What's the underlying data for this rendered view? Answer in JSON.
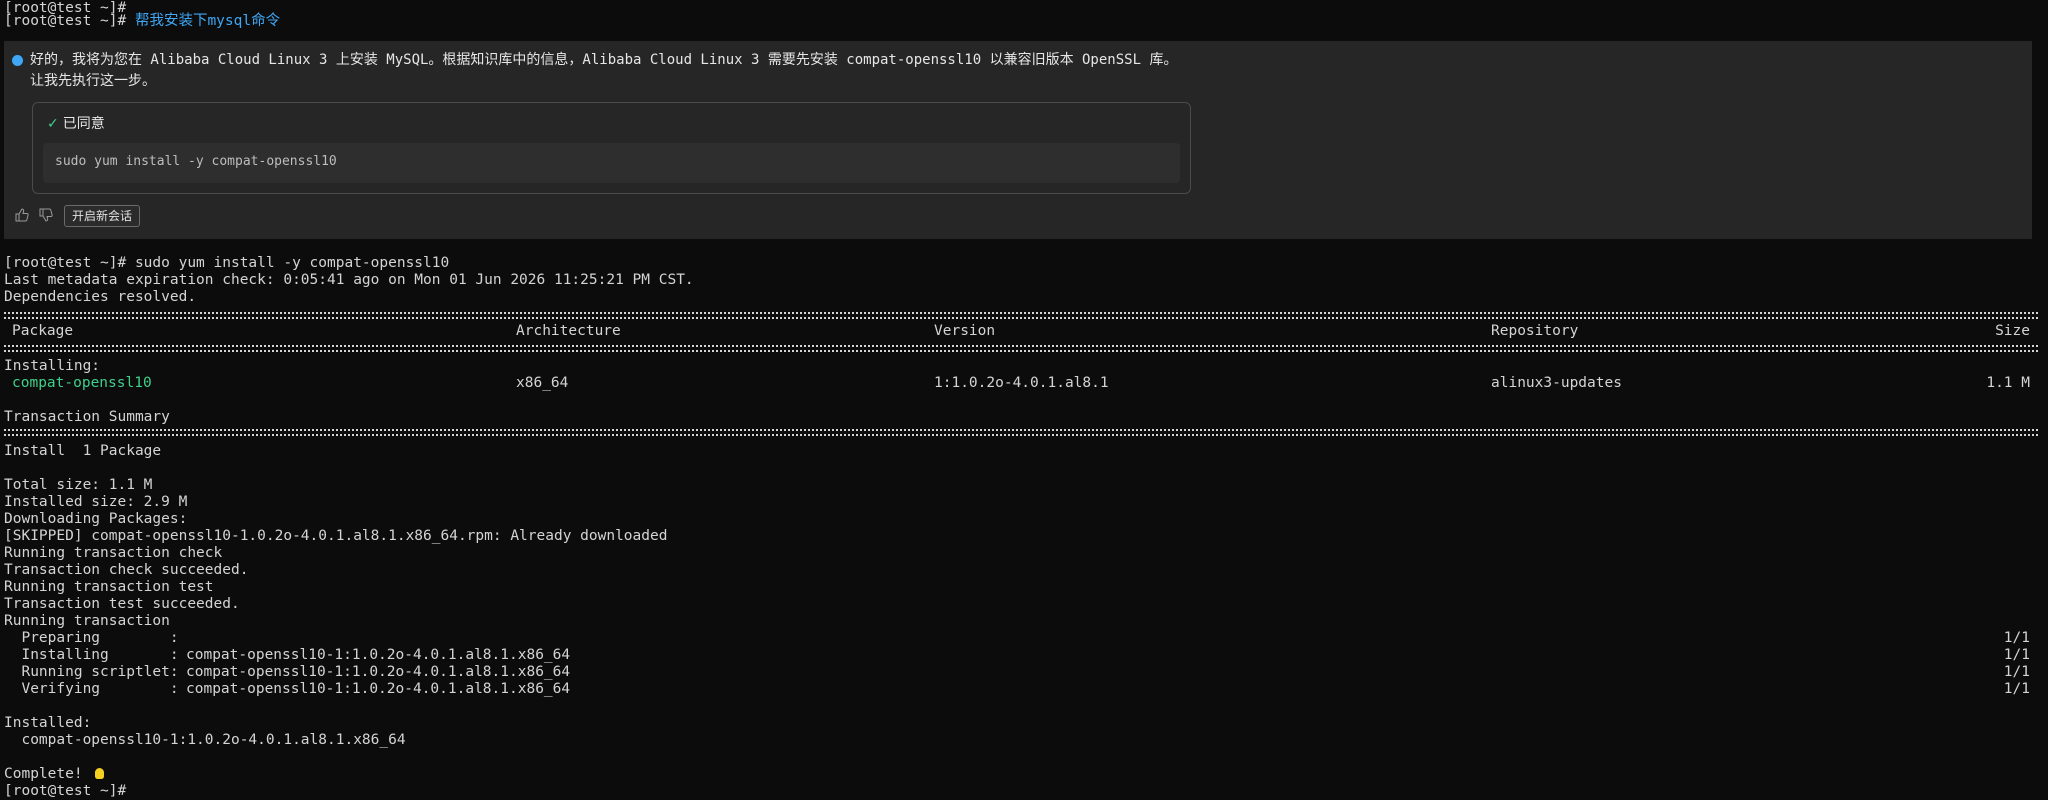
{
  "prompt_user": "[root@test ~]#",
  "first_line": "[root@test ~]#",
  "user_request": "帮我安装下mysql命令",
  "ai": {
    "message": "好的，我将为您在 Alibaba Cloud Linux 3 上安装 MySQL。根据知识库中的信息，Alibaba Cloud Linux 3 需要先安装 compat-openssl10 以兼容旧版本 OpenSSL 库。让我先执行这一步。",
    "approved_label": "已同意",
    "command": "sudo yum install -y compat-openssl10",
    "new_chat_label": "开启新会话",
    "icons": {
      "like": "thumbs-up-icon",
      "dislike": "thumbs-down-icon",
      "check": "check-icon",
      "status": "status-dot-icon"
    },
    "accent": "#3fa7f5"
  },
  "output": {
    "cmd_line": "[root@test ~]# sudo yum install -y compat-openssl10",
    "metadata": "Last metadata expiration check: 0:05:41 ago on Mon 01 Jun 2026 11:25:21 PM CST.",
    "deps": "Dependencies resolved.",
    "headers": {
      "package": "Package",
      "arch": "Architecture",
      "version": "Version",
      "repo": "Repository",
      "size": "Size"
    },
    "installing_label": "Installing:",
    "pkg": {
      "name": "compat-openssl10",
      "arch": "x86_64",
      "version": "1:1.0.2o-4.0.1.al8.1",
      "repo": "alinux3-updates",
      "size": "1.1 M"
    },
    "summary_title": "Transaction Summary",
    "install_count": "Install  1 Package",
    "total_size": "Total size: 1.1 M",
    "installed_size": "Installed size: 2.9 M",
    "downloading": "Downloading Packages:",
    "skipped": "[SKIPPED] compat-openssl10-1.0.2o-4.0.1.al8.1.x86_64.rpm: Already downloaded",
    "l1": "Running transaction check",
    "l2": "Transaction check succeeded.",
    "l3": "Running transaction test",
    "l4": "Transaction test succeeded.",
    "l5": "Running transaction",
    "steps": [
      {
        "label": "  Preparing        :",
        "pkg": "",
        "count": "1/1"
      },
      {
        "label": "  Installing       :",
        "pkg": "compat-openssl10-1:1.0.2o-4.0.1.al8.1.x86_64",
        "count": "1/1"
      },
      {
        "label": "  Running scriptlet:",
        "pkg": "compat-openssl10-1:1.0.2o-4.0.1.al8.1.x86_64",
        "count": "1/1"
      },
      {
        "label": "  Verifying        :",
        "pkg": "compat-openssl10-1:1.0.2o-4.0.1.al8.1.x86_64",
        "count": "1/1"
      }
    ],
    "installed_label": "Installed:",
    "installed_pkg": "  compat-openssl10-1:1.0.2o-4.0.1.al8.1.x86_64",
    "complete": "Complete!",
    "complete_icon": "lightbulb-icon",
    "last_prompt": "[root@test ~]#"
  }
}
